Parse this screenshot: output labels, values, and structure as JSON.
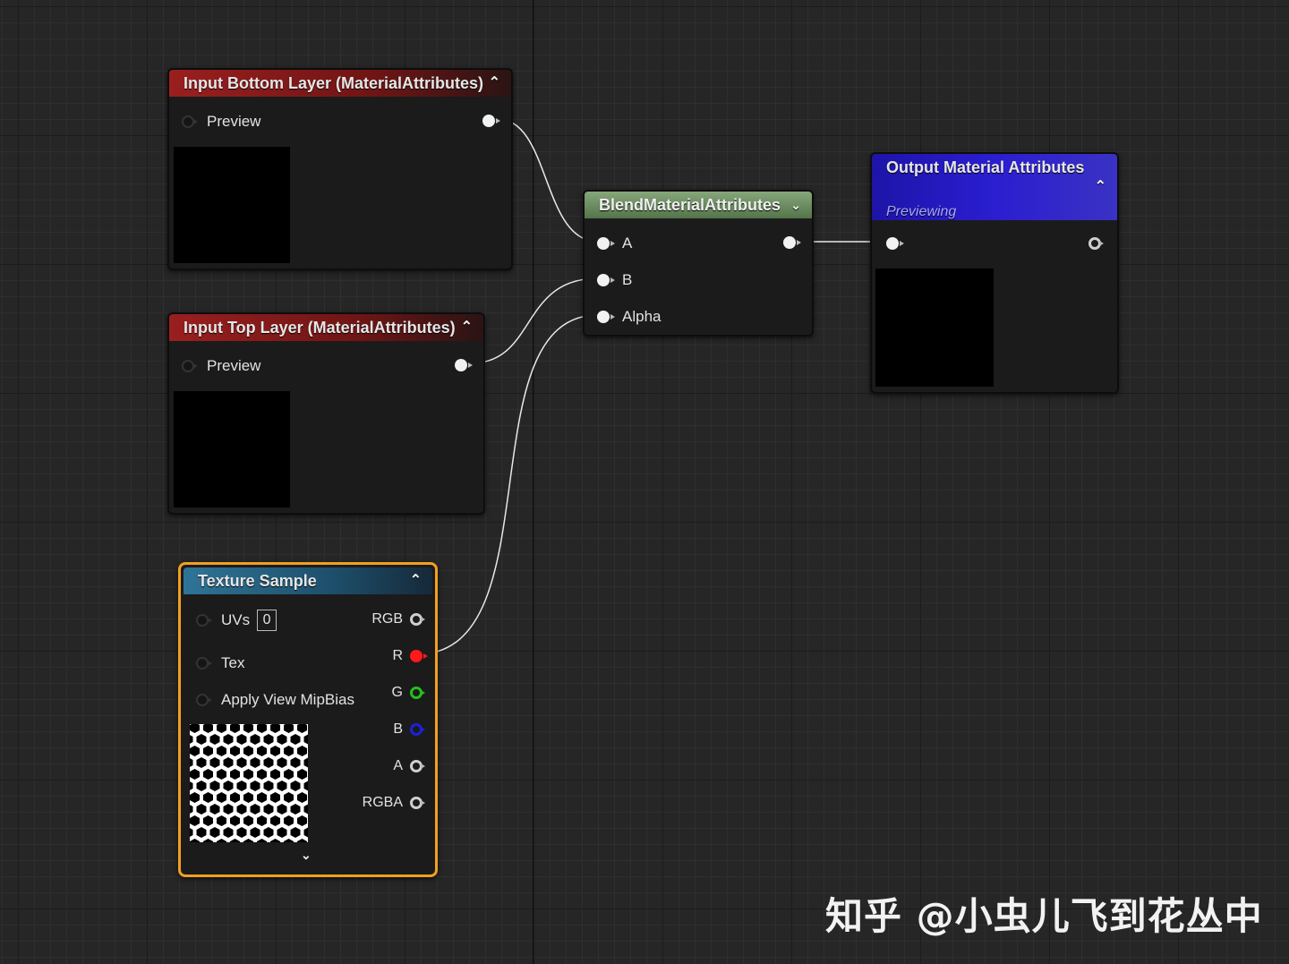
{
  "nodes": {
    "bottom_layer": {
      "title": "Input Bottom Layer (MaterialAttributes)",
      "preview_label": "Preview"
    },
    "top_layer": {
      "title": "Input Top Layer (MaterialAttributes)",
      "preview_label": "Preview"
    },
    "blend": {
      "title": "BlendMaterialAttributes",
      "inputs": [
        "A",
        "B",
        "Alpha"
      ]
    },
    "output": {
      "title": "Output Material Attributes",
      "subtitle": "Previewing"
    },
    "texture": {
      "title": "Texture Sample",
      "inputs": [
        "UVs",
        "Tex",
        "Apply View MipBias"
      ],
      "uv_value": "0",
      "outputs": [
        "RGB",
        "R",
        "G",
        "B",
        "A",
        "RGBA"
      ]
    }
  },
  "colors": {
    "material_attributes_header": "#9a1f1f",
    "blend_header": "#6e9062",
    "output_header": "#2a1ed0",
    "texture_header": "#2f7497",
    "selection_outline": "#f0a020",
    "pin_r": "#ff1a1a",
    "pin_g": "#23c01e",
    "pin_b": "#1a22d8"
  },
  "watermark": "知乎 @小虫儿飞到花丛中"
}
